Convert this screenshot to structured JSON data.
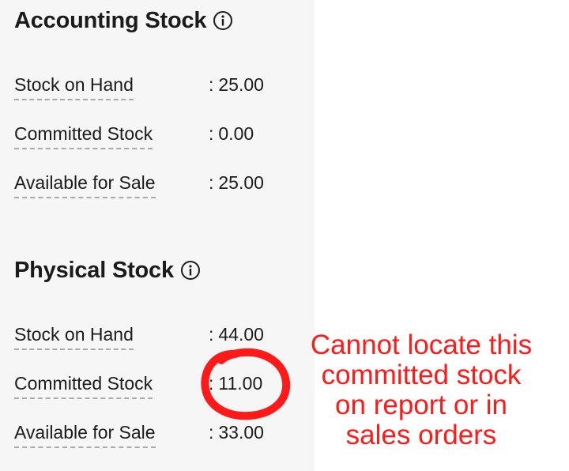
{
  "accounting": {
    "title": "Accounting Stock",
    "info_icon": "info-circle-icon",
    "rows": [
      {
        "label": "Stock on Hand",
        "value": "25.00"
      },
      {
        "label": "Committed Stock",
        "value": "0.00"
      },
      {
        "label": "Available for Sale",
        "value": "25.00"
      }
    ]
  },
  "physical": {
    "title": "Physical Stock",
    "info_icon": "info-circle-icon",
    "rows": [
      {
        "label": "Stock on Hand",
        "value": "44.00"
      },
      {
        "label": "Committed Stock",
        "value": "11.00"
      },
      {
        "label": "Available for Sale",
        "value": "33.00"
      }
    ]
  },
  "annotation": {
    "color": "#ff1a1a",
    "lines": [
      "Cannot locate this",
      "committed stock",
      "on report or in",
      "sales orders"
    ]
  },
  "colors": {
    "panel_background": "#f6f6f6",
    "text": "#1b1b1b",
    "dashed_underline": "#a9a9a9"
  }
}
